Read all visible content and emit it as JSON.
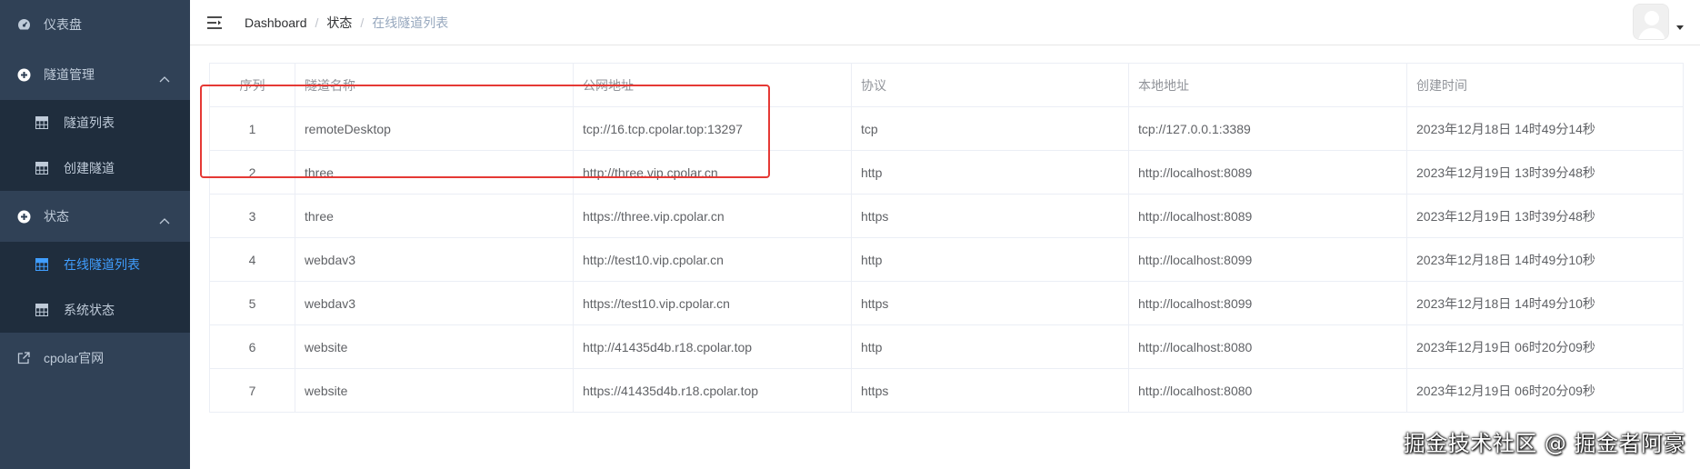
{
  "sidebar": {
    "items": [
      {
        "label": "仪表盘",
        "icon": "dashboard-icon"
      },
      {
        "label": "隧道管理",
        "icon": "tunnel-manage-icon",
        "expanded": true,
        "children": [
          {
            "label": "隧道列表",
            "icon": "grid-icon"
          },
          {
            "label": "创建隧道",
            "icon": "grid-icon"
          }
        ]
      },
      {
        "label": "状态",
        "icon": "status-icon",
        "expanded": true,
        "children": [
          {
            "label": "在线隧道列表",
            "icon": "grid-icon",
            "active": true
          },
          {
            "label": "系统状态",
            "icon": "grid-icon"
          }
        ]
      },
      {
        "label": "cpolar官网",
        "icon": "external-link-icon"
      }
    ]
  },
  "breadcrumb": [
    "Dashboard",
    "状态",
    "在线隧道列表"
  ],
  "table": {
    "headers": [
      "序列",
      "隧道名称",
      "公网地址",
      "协议",
      "本地地址",
      "创建时间"
    ],
    "rows": [
      [
        "1",
        "remoteDesktop",
        "tcp://16.tcp.cpolar.top:13297",
        "tcp",
        "tcp://127.0.0.1:3389",
        "2023年12月18日 14时49分14秒"
      ],
      [
        "2",
        "three",
        "http://three.vip.cpolar.cn",
        "http",
        "http://localhost:8089",
        "2023年12月19日 13时39分48秒"
      ],
      [
        "3",
        "three",
        "https://three.vip.cpolar.cn",
        "https",
        "http://localhost:8089",
        "2023年12月19日 13时39分48秒"
      ],
      [
        "4",
        "webdav3",
        "http://test10.vip.cpolar.cn",
        "http",
        "http://localhost:8099",
        "2023年12月18日 14时49分10秒"
      ],
      [
        "5",
        "webdav3",
        "https://test10.vip.cpolar.cn",
        "https",
        "http://localhost:8099",
        "2023年12月18日 14时49分10秒"
      ],
      [
        "6",
        "website",
        "http://41435d4b.r18.cpolar.top",
        "http",
        "http://localhost:8080",
        "2023年12月19日 06时20分09秒"
      ],
      [
        "7",
        "website",
        "https://41435d4b.r18.cpolar.top",
        "https",
        "http://localhost:8080",
        "2023年12月19日 06时20分09秒"
      ]
    ]
  },
  "watermark": "掘金技术社区 @ 掘金者阿豪",
  "colors": {
    "sidebar_bg": "#304156",
    "submenu_bg": "#1f2d3d",
    "active": "#409eff",
    "highlight": "#e53935"
  }
}
